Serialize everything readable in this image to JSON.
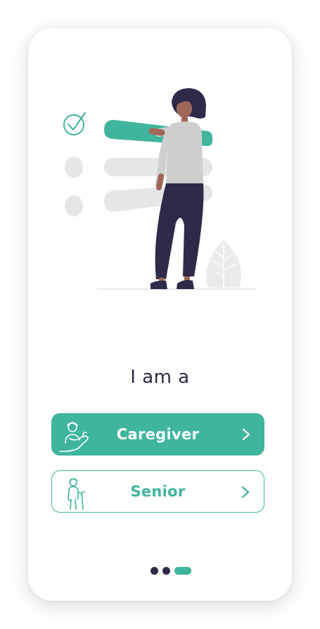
{
  "onboarding": {
    "question": "I am a",
    "options": [
      {
        "label": "Caregiver",
        "icon": "caregiver-icon",
        "style": "filled"
      },
      {
        "label": "Senior",
        "icon": "senior-icon",
        "style": "outlined"
      }
    ],
    "pager": {
      "total": 3,
      "current": 3
    }
  },
  "illustration": {
    "icon": "checklist-woman-illustration",
    "checked_items": 1,
    "total_items": 3
  },
  "colors": {
    "accent": "#40b59e",
    "text_dark": "#2e2a48",
    "muted_gray": "#e6e6e6",
    "background": "#ffffff"
  }
}
